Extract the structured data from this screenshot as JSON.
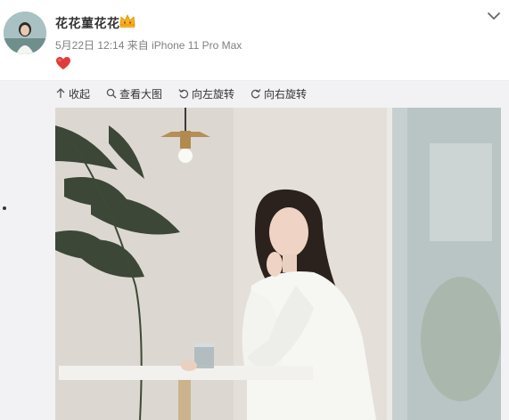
{
  "post": {
    "username": "花花菫花花",
    "date": "5月22日 12:14",
    "source_prefix": "来自",
    "source": "iPhone 11 Pro Max"
  },
  "icons": {
    "avatar": "avatar-portrait",
    "vip": "vip-crown-badge",
    "heart": "red-heart-emoji",
    "chevron": "chevron-down-icon",
    "collapse": "arrow-up-icon",
    "zoom": "magnifier-icon",
    "rotate_left": "rotate-left-icon",
    "rotate_right": "rotate-right-icon"
  },
  "toolbar": {
    "collapse_label": "收起",
    "view_large_label": "查看大图",
    "rotate_left_label": "向左旋转",
    "rotate_right_label": "向右旋转"
  },
  "colors": {
    "heart": "#e23b3b",
    "panel_bg": "#f2f2f5",
    "meta_text": "#808080"
  }
}
